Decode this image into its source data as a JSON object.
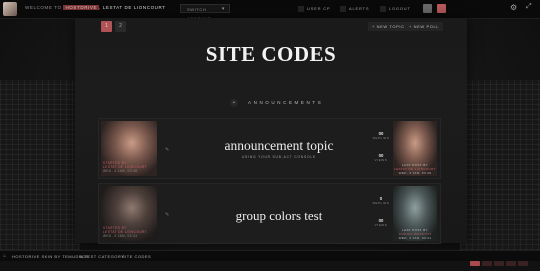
{
  "topbar": {
    "welcome_prefix": "WELCOME TO",
    "account": "HOSTDRIVE",
    "user": ", LESTAT DE LIONCOURT",
    "switch_label": "SWITCH ACCOUNT",
    "user_cp": "USER CP",
    "alerts": "ALERTS",
    "logout": "LOGOUT"
  },
  "panel": {
    "pages": [
      "1",
      "2"
    ],
    "new_topic": "+ NEW TOPIC",
    "new_poll": "+ NEW POLL",
    "title": "SITE CODES",
    "category": "ANNOUNCEMENTS"
  },
  "topics": [
    {
      "starter_caption_1": "STARTED BY",
      "starter_caption_2": "LESTAT DE LIONCOURT",
      "starter_caption_3": "WED, 4 JAN, 03:46",
      "title": "announcement topic",
      "subtitle": "USING YOUR SUB-ACT CONSOLE",
      "replies": "00",
      "replies_label": "REPLIES",
      "views": "00",
      "views_label": "VIEWS",
      "last_caption_1": "LAST POST BY",
      "last_caption_2": "LESTAT DE LIONCOURT",
      "last_caption_3": "WED, 4 JAN, 03:46"
    },
    {
      "starter_caption_1": "STARTED BY",
      "starter_caption_2": "LESTAT DE LIONCOURT",
      "starter_caption_3": "WED, 4 JAN, 03:41",
      "title": "group colors test",
      "subtitle": "",
      "replies": "0",
      "replies_label": "REPLIES",
      "views": "00",
      "views_label": "VIEWS",
      "last_caption_1": "LAST POST BY",
      "last_caption_2": "JOSHUA WASCOTT",
      "last_caption_3": "WED, 4 JAN, 03:41"
    }
  ],
  "bottombar": {
    "crumb_1": "HOSTDRIVE SKIN BY TEMUDROS",
    "crumb_2": "A TEST CATEGORY",
    "crumb_3": "SITE CODES"
  },
  "colors": {
    "accent": "#b05256",
    "background": "#121212",
    "panel": "#1a1a1a"
  }
}
